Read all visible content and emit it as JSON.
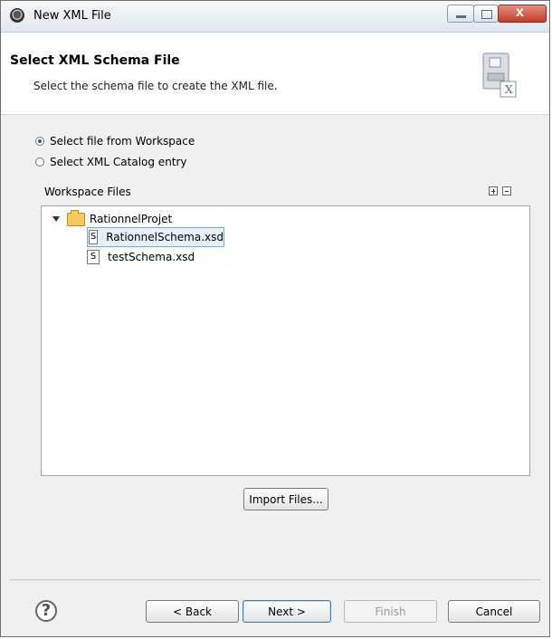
{
  "window": {
    "title": "New XML File"
  },
  "header": {
    "title": "Select XML Schema File",
    "subtitle": "Select the schema file to create the XML file."
  },
  "options": [
    {
      "label": "Select file from Workspace",
      "selected": true
    },
    {
      "label": "Select XML Catalog entry",
      "selected": false
    }
  ],
  "workspace": {
    "label": "Workspace Files",
    "tree": {
      "root": "RationnelProjet",
      "files": [
        "RationnelSchema.xsd",
        "testSchema.xsd"
      ],
      "selected": "RationnelSchema.xsd"
    }
  },
  "buttons": {
    "import": "Import Files...",
    "back": "< Back",
    "next": "Next >",
    "finish": "Finish",
    "cancel": "Cancel",
    "help": "?"
  },
  "icons": [
    "app-icon",
    "xml-schema-icon",
    "folder-icon",
    "schema-file-icon",
    "help-icon",
    "expand-all-icon",
    "collapse-all-icon"
  ],
  "colors": {
    "selection": "#e8f2ff",
    "selectionBorder": "#7fa6d8",
    "background": "#f0f0f0"
  }
}
